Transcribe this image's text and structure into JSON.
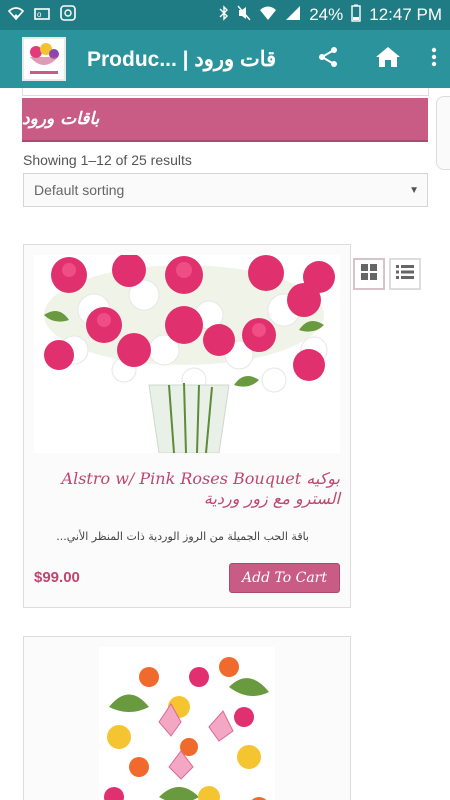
{
  "status_bar": {
    "battery": "24%",
    "time": "12:47 PM",
    "icons": [
      "wifi-icon",
      "outlook-icon",
      "vpn-icon",
      "bluetooth-icon",
      "mute-icon",
      "wifi-signal-icon",
      "cell-signal-icon",
      "battery-icon"
    ]
  },
  "app_bar": {
    "title": "Produc... | باقات ورود",
    "actions": [
      "share-icon",
      "home-icon",
      "more-vert-icon"
    ],
    "color": "#2a939c"
  },
  "page": {
    "category_title": "باقات ورود",
    "results_text": "Showing 1–12 of 25 results",
    "sort_selected": "Default sorting",
    "accent": "#c85c84"
  },
  "products": [
    {
      "title": "بوكيه Alstro w/ Pink Roses Bouquet السترو مع زور وردية",
      "description": "...باقة الحب الجميلة من الروز الوردية ذات المنظر الأني",
      "price": "$99.00",
      "button": "Add To Cart"
    }
  ]
}
